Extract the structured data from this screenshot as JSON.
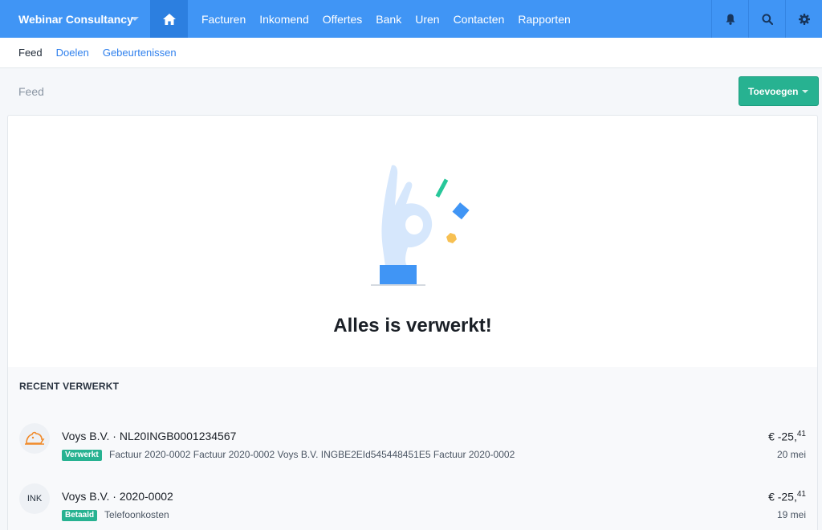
{
  "header": {
    "company": "Webinar Consultancy",
    "nav": [
      "Facturen",
      "Inkomend",
      "Offertes",
      "Bank",
      "Uren",
      "Contacten",
      "Rapporten"
    ]
  },
  "subtabs": [
    "Feed",
    "Doelen",
    "Gebeurtenissen"
  ],
  "page": {
    "title": "Feed",
    "add_label": "Toevoegen"
  },
  "empty_state": {
    "title": "Alles is verwerkt!"
  },
  "recent": {
    "heading": "RECENT VERWERKT",
    "items": [
      {
        "title": "Voys B.V. · NL20INGB0001234567",
        "status": "Verwerkt",
        "description": "Factuur 2020-0002 Factuur 2020-0002 Voys B.V. INGBE2EId545448451E5 Factuur 2020-0002",
        "amount_main": "€ -25,",
        "amount_cents": "41",
        "date": "20 mei"
      },
      {
        "avatar_text": "INK",
        "title": "Voys B.V. · 2020-0002",
        "status": "Betaald",
        "description": "Telefoonkosten",
        "amount_main": "€ -25,",
        "amount_cents": "41",
        "date": "19 mei"
      }
    ]
  },
  "colors": {
    "brand_blue": "#4095f5",
    "accent_green": "#27b291"
  },
  "icons": [
    "home-icon",
    "bell-icon",
    "search-icon",
    "gear-icon",
    "bank-logo-icon"
  ]
}
